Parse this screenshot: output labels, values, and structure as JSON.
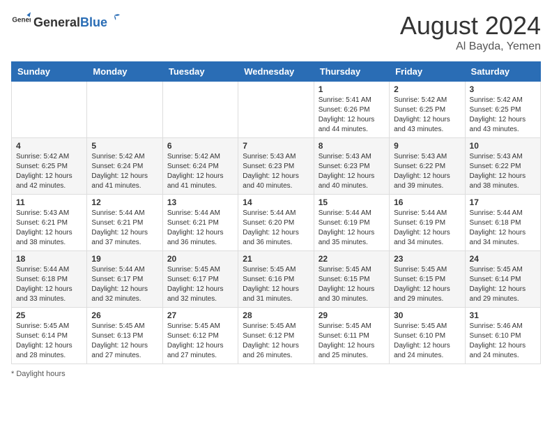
{
  "header": {
    "logo_general": "General",
    "logo_blue": "Blue",
    "month_year": "August 2024",
    "location": "Al Bayda, Yemen"
  },
  "days_of_week": [
    "Sunday",
    "Monday",
    "Tuesday",
    "Wednesday",
    "Thursday",
    "Friday",
    "Saturday"
  ],
  "footer": {
    "note": "Daylight hours"
  },
  "weeks": [
    [
      {
        "day": "",
        "sunrise": "",
        "sunset": "",
        "daylight": ""
      },
      {
        "day": "",
        "sunrise": "",
        "sunset": "",
        "daylight": ""
      },
      {
        "day": "",
        "sunrise": "",
        "sunset": "",
        "daylight": ""
      },
      {
        "day": "",
        "sunrise": "",
        "sunset": "",
        "daylight": ""
      },
      {
        "day": "1",
        "sunrise": "5:41 AM",
        "sunset": "6:26 PM",
        "daylight": "12 hours and 44 minutes."
      },
      {
        "day": "2",
        "sunrise": "5:42 AM",
        "sunset": "6:25 PM",
        "daylight": "12 hours and 43 minutes."
      },
      {
        "day": "3",
        "sunrise": "5:42 AM",
        "sunset": "6:25 PM",
        "daylight": "12 hours and 43 minutes."
      }
    ],
    [
      {
        "day": "4",
        "sunrise": "5:42 AM",
        "sunset": "6:25 PM",
        "daylight": "12 hours and 42 minutes."
      },
      {
        "day": "5",
        "sunrise": "5:42 AM",
        "sunset": "6:24 PM",
        "daylight": "12 hours and 41 minutes."
      },
      {
        "day": "6",
        "sunrise": "5:42 AM",
        "sunset": "6:24 PM",
        "daylight": "12 hours and 41 minutes."
      },
      {
        "day": "7",
        "sunrise": "5:43 AM",
        "sunset": "6:23 PM",
        "daylight": "12 hours and 40 minutes."
      },
      {
        "day": "8",
        "sunrise": "5:43 AM",
        "sunset": "6:23 PM",
        "daylight": "12 hours and 40 minutes."
      },
      {
        "day": "9",
        "sunrise": "5:43 AM",
        "sunset": "6:22 PM",
        "daylight": "12 hours and 39 minutes."
      },
      {
        "day": "10",
        "sunrise": "5:43 AM",
        "sunset": "6:22 PM",
        "daylight": "12 hours and 38 minutes."
      }
    ],
    [
      {
        "day": "11",
        "sunrise": "5:43 AM",
        "sunset": "6:21 PM",
        "daylight": "12 hours and 38 minutes."
      },
      {
        "day": "12",
        "sunrise": "5:44 AM",
        "sunset": "6:21 PM",
        "daylight": "12 hours and 37 minutes."
      },
      {
        "day": "13",
        "sunrise": "5:44 AM",
        "sunset": "6:21 PM",
        "daylight": "12 hours and 36 minutes."
      },
      {
        "day": "14",
        "sunrise": "5:44 AM",
        "sunset": "6:20 PM",
        "daylight": "12 hours and 36 minutes."
      },
      {
        "day": "15",
        "sunrise": "5:44 AM",
        "sunset": "6:19 PM",
        "daylight": "12 hours and 35 minutes."
      },
      {
        "day": "16",
        "sunrise": "5:44 AM",
        "sunset": "6:19 PM",
        "daylight": "12 hours and 34 minutes."
      },
      {
        "day": "17",
        "sunrise": "5:44 AM",
        "sunset": "6:18 PM",
        "daylight": "12 hours and 34 minutes."
      }
    ],
    [
      {
        "day": "18",
        "sunrise": "5:44 AM",
        "sunset": "6:18 PM",
        "daylight": "12 hours and 33 minutes."
      },
      {
        "day": "19",
        "sunrise": "5:44 AM",
        "sunset": "6:17 PM",
        "daylight": "12 hours and 32 minutes."
      },
      {
        "day": "20",
        "sunrise": "5:45 AM",
        "sunset": "6:17 PM",
        "daylight": "12 hours and 32 minutes."
      },
      {
        "day": "21",
        "sunrise": "5:45 AM",
        "sunset": "6:16 PM",
        "daylight": "12 hours and 31 minutes."
      },
      {
        "day": "22",
        "sunrise": "5:45 AM",
        "sunset": "6:15 PM",
        "daylight": "12 hours and 30 minutes."
      },
      {
        "day": "23",
        "sunrise": "5:45 AM",
        "sunset": "6:15 PM",
        "daylight": "12 hours and 29 minutes."
      },
      {
        "day": "24",
        "sunrise": "5:45 AM",
        "sunset": "6:14 PM",
        "daylight": "12 hours and 29 minutes."
      }
    ],
    [
      {
        "day": "25",
        "sunrise": "5:45 AM",
        "sunset": "6:14 PM",
        "daylight": "12 hours and 28 minutes."
      },
      {
        "day": "26",
        "sunrise": "5:45 AM",
        "sunset": "6:13 PM",
        "daylight": "12 hours and 27 minutes."
      },
      {
        "day": "27",
        "sunrise": "5:45 AM",
        "sunset": "6:12 PM",
        "daylight": "12 hours and 27 minutes."
      },
      {
        "day": "28",
        "sunrise": "5:45 AM",
        "sunset": "6:12 PM",
        "daylight": "12 hours and 26 minutes."
      },
      {
        "day": "29",
        "sunrise": "5:45 AM",
        "sunset": "6:11 PM",
        "daylight": "12 hours and 25 minutes."
      },
      {
        "day": "30",
        "sunrise": "5:45 AM",
        "sunset": "6:10 PM",
        "daylight": "12 hours and 24 minutes."
      },
      {
        "day": "31",
        "sunrise": "5:46 AM",
        "sunset": "6:10 PM",
        "daylight": "12 hours and 24 minutes."
      }
    ]
  ]
}
